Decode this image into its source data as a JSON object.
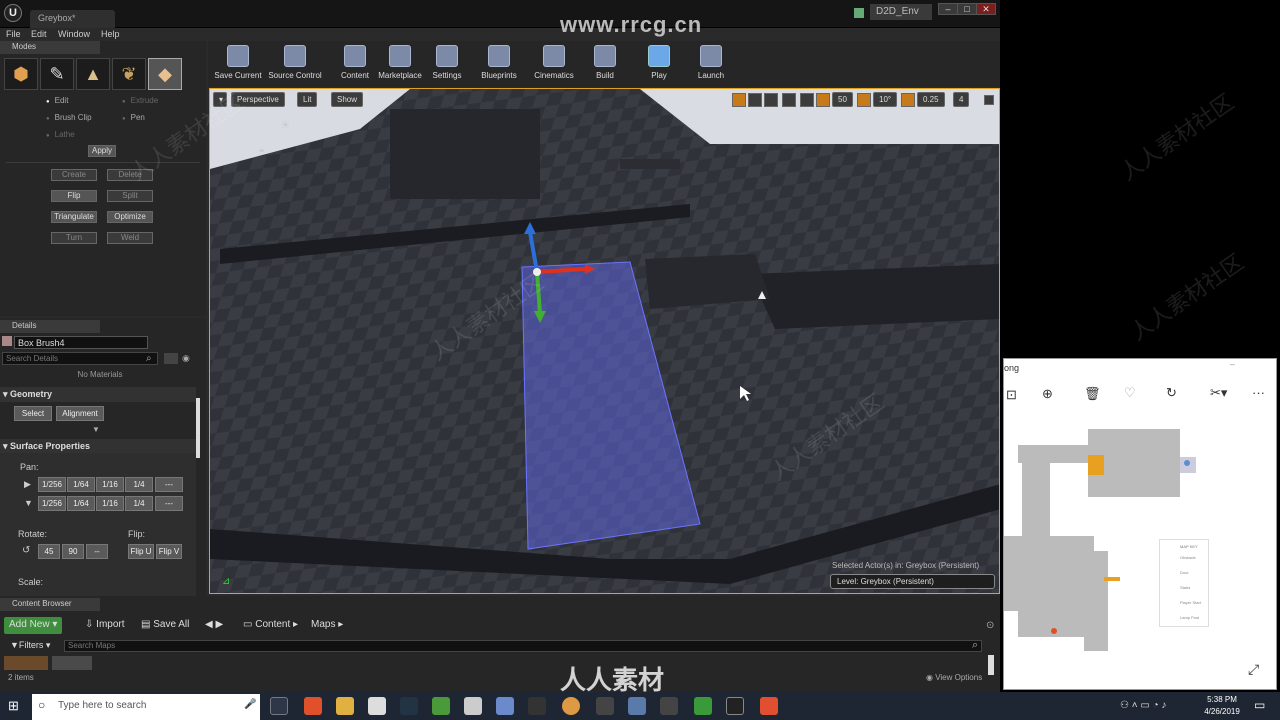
{
  "watermark_url": "www.rrcg.cn",
  "watermark_bottom": "人人素材",
  "watermark_tile": "人人素材社区",
  "titlebar": {
    "doc_tab": "Greybox*",
    "env_tab": "D2D_Env",
    "window_buttons": [
      "–",
      "□",
      "✕"
    ]
  },
  "menu": [
    "File",
    "Edit",
    "Window",
    "Help"
  ],
  "modes": {
    "tab_label": "Modes",
    "options": [
      {
        "label": "Edit",
        "state": "on"
      },
      {
        "label": "Extrude",
        "state": "dim"
      },
      {
        "label": "Brush Clip",
        "state": "off"
      },
      {
        "label": "Pen",
        "state": "off"
      },
      {
        "label": "Lathe",
        "state": "dim"
      }
    ],
    "apply_label": "Apply",
    "buttons": [
      {
        "label": "Create",
        "disabled": true
      },
      {
        "label": "Delete",
        "disabled": true
      },
      {
        "label": "Flip",
        "disabled": false
      },
      {
        "label": "Split",
        "disabled": true
      },
      {
        "label": "Triangulate",
        "disabled": false
      },
      {
        "label": "Optimize",
        "disabled": false
      },
      {
        "label": "Turn",
        "disabled": true
      },
      {
        "label": "Weld",
        "disabled": true
      }
    ]
  },
  "details": {
    "tab_label": "Details",
    "actor_name": "Box Brush4",
    "search_placeholder": "Search Details",
    "no_materials": "No Materials",
    "geometry_header": "Geometry",
    "select_label": "Select",
    "alignment_label": "Alignment",
    "surface_header": "Surface Properties",
    "pan_label": "Pan:",
    "pan_values": [
      "1/256",
      "1/64",
      "1/16",
      "1/4",
      "---"
    ],
    "rotate_label": "Rotate:",
    "rotate_values": [
      "45",
      "90",
      "--"
    ],
    "flip_label": "Flip:",
    "flip_u": "Flip U",
    "flip_v": "Flip V",
    "scale_label": "Scale:"
  },
  "toolbar": [
    {
      "label": "Save Current",
      "icon": "save-icon"
    },
    {
      "label": "Source Control",
      "icon": "source-control-icon"
    },
    {
      "label": "Content",
      "icon": "content-icon"
    },
    {
      "label": "Marketplace",
      "icon": "marketplace-icon"
    },
    {
      "label": "Settings",
      "icon": "settings-icon"
    },
    {
      "label": "Blueprints",
      "icon": "blueprints-icon"
    },
    {
      "label": "Cinematics",
      "icon": "cinematics-icon"
    },
    {
      "label": "Build",
      "icon": "build-icon"
    },
    {
      "label": "Play",
      "icon": "play-icon"
    },
    {
      "label": "Launch",
      "icon": "launch-icon"
    }
  ],
  "viewport": {
    "perspective": "Perspective",
    "lit": "Lit",
    "show": "Show",
    "grid_snap": "50",
    "rot_snap": "10°",
    "scale_snap": "0.25",
    "camera_speed": "4",
    "selected_text": "Selected Actor(s) in: Greybox (Persistent)",
    "level_text": "Level: Greybox (Persistent)"
  },
  "content_browser": {
    "tab_label": "Content Browser",
    "add_new": "Add New",
    "import": "Import",
    "save_all": "Save All",
    "path": [
      "Content",
      "Maps"
    ],
    "filters": "Filters",
    "search_placeholder": "Search Maps",
    "item_count": "2 items",
    "view_options": "View Options"
  },
  "photos": {
    "title": "ong",
    "legend_title": "MAP KEY",
    "legend": [
      "Obstacle",
      "Door",
      "Stairs",
      "Player Start",
      "Lamp Post"
    ]
  },
  "taskbar": {
    "search_placeholder": "Type here to search",
    "time": "5:38 PM",
    "date": "4/26/2019"
  }
}
